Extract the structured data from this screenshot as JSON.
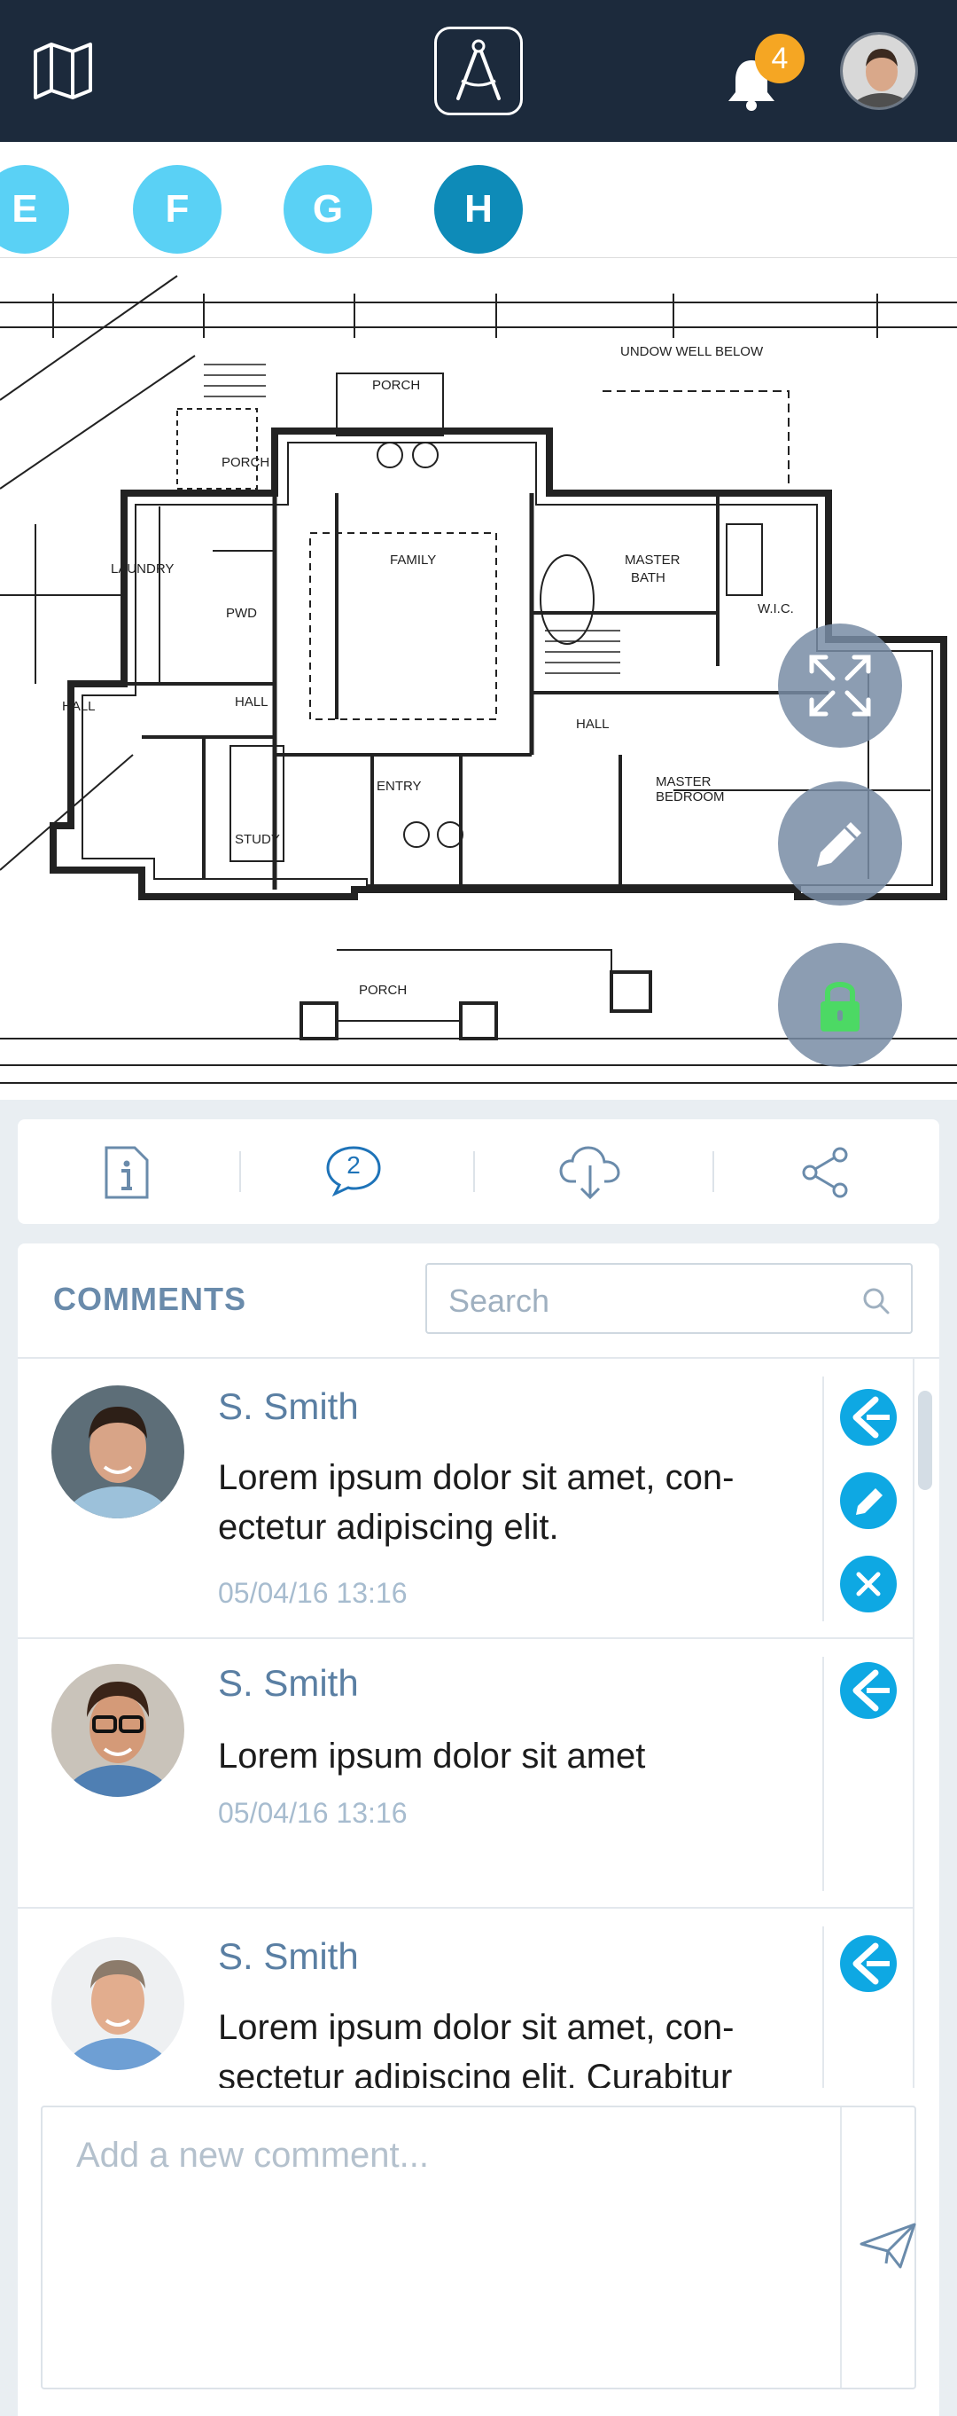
{
  "header": {
    "notification_count": "4"
  },
  "sheet_tabs": [
    "E",
    "F",
    "G",
    "H"
  ],
  "toolbar": {
    "comment_count": "2"
  },
  "comments": {
    "title": "COMMENTS",
    "search_placeholder": "Search",
    "items": [
      {
        "author": "S. Smith",
        "text": "Lorem ipsum dolor sit amet, con-ectetur adipiscing elit.",
        "date": "05/04/16 13:16"
      },
      {
        "author": "S. Smith",
        "text": "Lorem ipsum dolor sit amet",
        "date": "05/04/16 13:16"
      },
      {
        "author": "S. Smith",
        "text": "Lorem ipsum dolor sit amet, con-sectetur adipiscing elit. Curabitur",
        "date": ""
      }
    ],
    "composer_placeholder": "Add a new comment..."
  },
  "colors": {
    "header_bg": "#1c2a3c",
    "accent": "#0ea8e3",
    "tab_active": "#0e8bb8",
    "tab_inactive": "#5ad1f5",
    "lock_green": "#4cd964"
  }
}
